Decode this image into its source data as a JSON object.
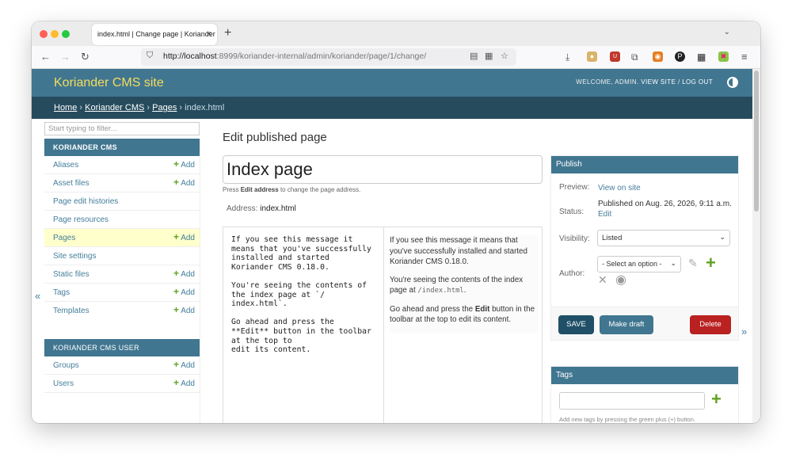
{
  "browser": {
    "tab_title": "index.html | Change page | Koriander",
    "tab_close": "×",
    "new_tab": "+",
    "url_host": "http://localhost",
    "url_rest": ":8999/koriander-internal/admin/koriander/page/1/change/"
  },
  "header": {
    "site_title": "Koriander CMS site",
    "welcome": "WELCOME,",
    "user": "ADMIN.",
    "view_site": "VIEW SITE",
    "separator": "/",
    "log_out": "LOG OUT"
  },
  "breadcrumbs": {
    "home": "Home",
    "app": "Koriander CMS",
    "model": "Pages",
    "current": "index.html",
    "sep": "›"
  },
  "sidebar": {
    "filter_placeholder": "Start typing to filter...",
    "group1_title": "KORIANDER CMS",
    "add_label": "Add",
    "items": [
      {
        "label": "Aliases",
        "add": true
      },
      {
        "label": "Asset files",
        "add": true
      },
      {
        "label": "Page edit histories",
        "add": false
      },
      {
        "label": "Page resources",
        "add": false
      },
      {
        "label": "Pages",
        "add": true
      },
      {
        "label": "Site settings",
        "add": false
      },
      {
        "label": "Static files",
        "add": true
      },
      {
        "label": "Tags",
        "add": true
      },
      {
        "label": "Templates",
        "add": true
      }
    ],
    "group2_title": "KORIANDER CMS USER",
    "items2": [
      {
        "label": "Groups",
        "add": true
      },
      {
        "label": "Users",
        "add": true
      }
    ],
    "collapse": "«",
    "expand": "»"
  },
  "main": {
    "heading": "Edit published page",
    "title_value": "Index page",
    "help_pre": "Press",
    "help_bold": "Edit address",
    "help_post": "to change the page address.",
    "address_label": "Address:",
    "address_value": "index.html",
    "editor_source": "If you see this message it\nmeans that you've successfully\ninstalled and started\nKoriander CMS 0.18.0.\n\nYou're seeing the contents of\nthe index page at `/\nindex.html`.\n\nGo ahead and press the\n**Edit** button in the toolbar\nat the top to\nedit its content.",
    "preview_p1": "If you see this message it means that you've successfully installed and started Koriander CMS 0.18.0.",
    "preview_p2_pre": "You're seeing the contents of the index page at",
    "preview_p2_code": "/index.html",
    "preview_p2_post": ".",
    "preview_p3_pre": "Go ahead and press the",
    "preview_p3_bold": "Edit",
    "preview_p3_post": "button in the toolbar at the top to edit its content."
  },
  "publish": {
    "title": "Publish",
    "preview_label": "Preview:",
    "preview_link": "View on site",
    "status_label": "Status:",
    "status_value": "Published on Aug. 26, 2026, 9:11 a.m.",
    "status_edit": "Edit",
    "visibility_label": "Visibility:",
    "visibility_value": "Listed",
    "author_label": "Author:",
    "author_value": "- Select an option -",
    "save": "SAVE",
    "make_draft": "Make draft",
    "delete": "Delete"
  },
  "tags": {
    "title": "Tags",
    "help": "Add new tags by pressing the green plus (+) button."
  }
}
